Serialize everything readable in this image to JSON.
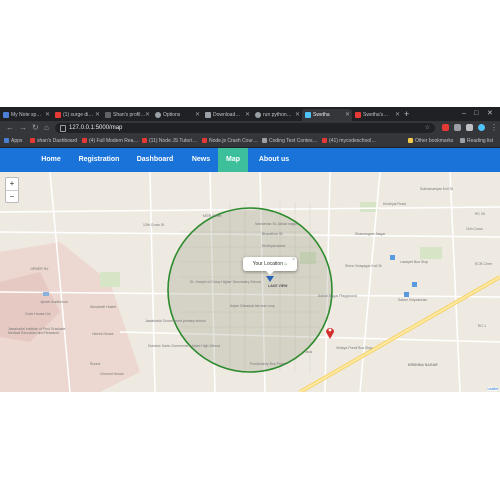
{
  "browser": {
    "tabs": [
      {
        "label": "My Note sp…",
        "color": "#4a7fd4"
      },
      {
        "label": "(1) surge di…",
        "color": "#e53935"
      },
      {
        "label": "Shan's profil…",
        "color": "#5f6368"
      },
      {
        "label": "Options",
        "color": "#9aa0a6"
      },
      {
        "label": "Download…",
        "color": "#9aa0a6"
      },
      {
        "label": "run python…",
        "color": "#9aa0a6"
      },
      {
        "label": "Swetha",
        "color": "#4fc3f7"
      },
      {
        "label": "Swetha's…",
        "color": "#e53935"
      }
    ],
    "new_tab": "+",
    "url": "127.0.0.1:5000/map",
    "bookmarks": [
      {
        "label": "Apps",
        "color": "#4a7fd4"
      },
      {
        "label": "shan's Dashboard",
        "color": "#e53935"
      },
      {
        "label": "(4) Full Modern Rea…",
        "color": "#e53935"
      },
      {
        "label": "(11) Node JS Tutori…",
        "color": "#e53935"
      },
      {
        "label": "Node.js Crash Cour…",
        "color": "#e53935"
      },
      {
        "label": "Coding Test Contes…",
        "color": "#9aa0a6"
      },
      {
        "label": "(41) mycodeschool…",
        "color": "#e53935"
      },
      {
        "label": "Other bookmarks",
        "color": "#f2c94c"
      },
      {
        "label": "Reading list",
        "color": "#9aa0a6"
      }
    ]
  },
  "nav": {
    "items": [
      "Home",
      "Registration",
      "Dashboard",
      "News",
      "Map",
      "About us"
    ],
    "active": "Map"
  },
  "map": {
    "zoom_in": "+",
    "zoom_out": "−",
    "popup_text": "Your Location",
    "popup_close": "×",
    "attribution": "Leaflet",
    "marker_label": "LAKE VIEW",
    "circle_color": "#2e8b2e",
    "labels": {
      "subramaniyar": "Subramaniyar Koil St",
      "mgr": "MGR Street",
      "vamdevan": "Vamdevan St, Ashok nagar",
      "bharathiar": "Bharathiar St",
      "kindhyal": "Kindhyal street",
      "cross12": "12th Cross St",
      "cross11": "11th Cross",
      "kindhyal_road": "Kindhyal Road",
      "shiva": "Shiva Vinayagar Koil St",
      "st_joseph": "St. Joseph of Cluny Higher Secondary School",
      "anjan": "Anjan Classical lab and coop",
      "ashok_playground": "Ashok Nagar Playground",
      "woodwell": "Woodwell Hostel",
      "jawaharlal_school": "Jawaharlal Government primary school",
      "harres": "Harres House",
      "dominic": "Dominic Savio Government Aided High School",
      "krishna": "KRISHNA NAGAR",
      "vellaya": "Vellaya Pondi Bus Stop",
      "salam": "Salam Vidyashram",
      "lawspet": "Lawspet Bus Stop",
      "rc26": "RC 26",
      "ecr": "ECR-Chen",
      "ilsus": "Ilsus",
      "pondy": "Pondicherry Bus Point",
      "jipmer": "Jawaharlal Institute of Post Graduate Medical Education and Research",
      "curie": "Curie House Ltd",
      "jipmer_rd": "JIPMER Rd",
      "auditorium": "Jipmer Auditorium",
      "round": "Round",
      "ormond": "Ormond House",
      "shanmugam": "Shanmugam Nagar",
      "rc": "RC-1"
    }
  }
}
